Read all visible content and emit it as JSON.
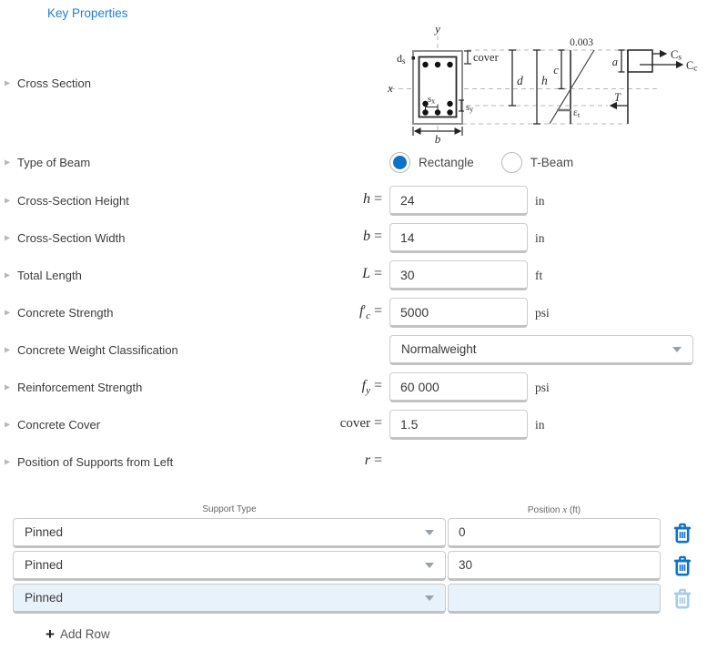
{
  "header": {
    "title": "Key Properties"
  },
  "colors": {
    "accent": "#0f72c9",
    "accent_disabled": "#a7cbec",
    "link": "#1b80d4"
  },
  "fields": [
    {
      "label": "Cross Section"
    },
    {
      "label": "Type of Beam"
    },
    {
      "label": "Cross-Section Height",
      "math": {
        "base": "h",
        "prime": "",
        "sub": "",
        "eq": "="
      },
      "value": "24",
      "unit": "in"
    },
    {
      "label": "Cross-Section Width",
      "math": {
        "base": "b",
        "prime": "",
        "sub": "",
        "eq": "="
      },
      "value": "14",
      "unit": "in"
    },
    {
      "label": "Total Length",
      "math": {
        "base": "L",
        "prime": "",
        "sub": "",
        "eq": "="
      },
      "value": "30",
      "unit": "ft"
    },
    {
      "label": "Concrete Strength",
      "math": {
        "base": "f",
        "prime": "′",
        "sub": "c",
        "eq": "="
      },
      "value": "5000",
      "unit": "psi"
    },
    {
      "label": "Concrete Weight Classification",
      "select_value": "Normalweight"
    },
    {
      "label": "Reinforcement Strength",
      "math": {
        "base": "f",
        "prime": "",
        "sub": "y",
        "eq": "="
      },
      "value": "60 000",
      "unit": "psi"
    },
    {
      "label": "Concrete Cover",
      "math": {
        "base": "cover",
        "prime": "",
        "sub": "",
        "eq": "="
      },
      "value": "1.5",
      "unit": "in"
    },
    {
      "label": "Position of Supports from Left",
      "math": {
        "base": "r",
        "prime": "",
        "sub": "",
        "eq": "="
      }
    }
  ],
  "beam_type": {
    "options": [
      {
        "label": "Rectangle",
        "selected": true
      },
      {
        "label": "T-Beam",
        "selected": false
      }
    ]
  },
  "diagram": {
    "y_axis": "y",
    "x_axis": "x",
    "ds": {
      "base": "d",
      "sub": "s"
    },
    "cover": "cover",
    "sx": {
      "base": "s",
      "sub": "x"
    },
    "sy": {
      "base": "s",
      "sub": "y"
    },
    "b": "b",
    "d": "d",
    "h": "h",
    "c": "c",
    "a": "a",
    "strain_top": "0.003",
    "epsilon_t": {
      "base": "ε",
      "sub": "t"
    },
    "cs": {
      "base": "C",
      "sub": "s"
    },
    "cc": {
      "base": "C",
      "sub": "c"
    },
    "t": "T"
  },
  "support_table": {
    "header_support": "Support Type",
    "header_position_pre": "Position",
    "header_position_var": "x",
    "header_position_post": "(ft)",
    "rows": [
      {
        "support_type": "Pinned",
        "position": "0"
      },
      {
        "support_type": "Pinned",
        "position": "30"
      },
      {
        "support_type": "Pinned",
        "position": ""
      }
    ],
    "add_row_icon": "+",
    "add_row_label": "Add Row"
  }
}
